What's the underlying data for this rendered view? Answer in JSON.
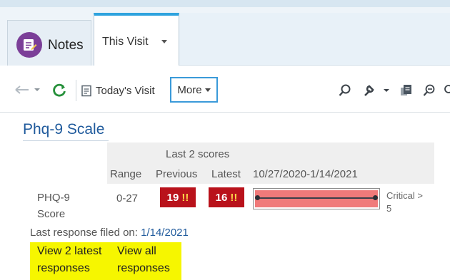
{
  "tabs": {
    "notes_label": "Notes",
    "visit_label": "This Visit"
  },
  "toolbar": {
    "todays_visit_label": "Today's Visit",
    "more_label": "More"
  },
  "section": {
    "title": "Phq-9 Scale"
  },
  "table": {
    "group_header": "Last 2 scores",
    "headers": {
      "range": "Range",
      "previous": "Previous",
      "latest": "Latest",
      "date_range": "10/27/2020-1/14/2021"
    },
    "row": {
      "label_line1": "PHQ-9",
      "label_line2": "Score",
      "range": "0-27",
      "previous": "19",
      "latest": "16",
      "flag": "!!",
      "critical_line1": "Critical >",
      "critical_line2": "5"
    }
  },
  "footer": {
    "last_response_label": "Last response filed on:",
    "last_response_date": "1/14/2021",
    "link_latest_line1": "View 2 latest",
    "link_latest_line2": "responses",
    "link_all_line1": "View all",
    "link_all_line2": "responses"
  },
  "colors": {
    "accent": "#2ea3de",
    "notes_badge": "#7b3f98",
    "score_flag": "#b9121b",
    "graph_fill": "#f07a7a",
    "title": "#1f5a9c",
    "highlight": "#f6f600"
  },
  "icons": [
    "notes-icon",
    "back-arrow-icon",
    "refresh-icon",
    "calendar-icon",
    "search-icon",
    "wrench-icon",
    "clipboard-icon",
    "zoom-icon"
  ]
}
